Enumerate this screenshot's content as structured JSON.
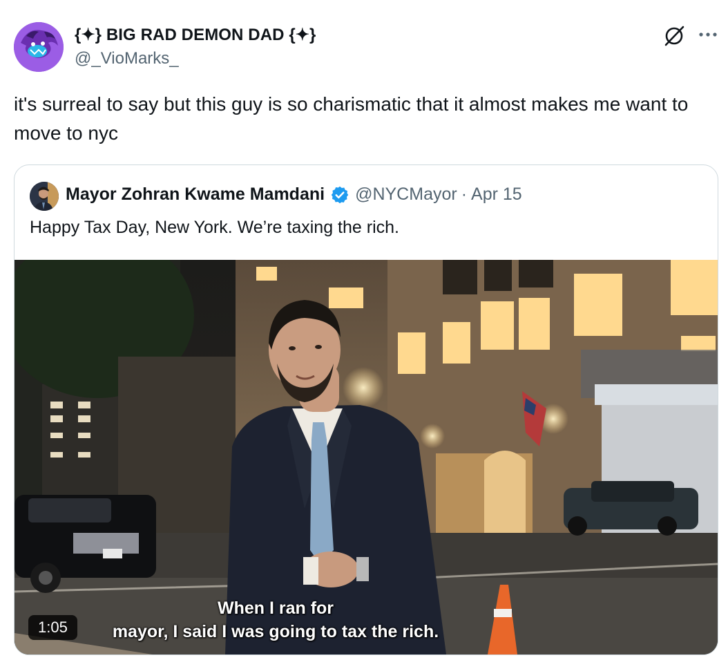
{
  "author": {
    "display_name": "{✦} BIG RAD DEMON DAD {✦}",
    "handle": "@_VioMarks_",
    "avatar_icon": "purple-demon-avatar"
  },
  "header_actions": {
    "grok_icon": "grok-icon",
    "more_icon": "more-dots-icon"
  },
  "tweet": {
    "text": "it's surreal to say but this guy is so charismatic that it almost makes me want to move to nyc"
  },
  "quoted_tweet": {
    "display_name": "Mayor Zohran Kwame Mamdani",
    "verified": true,
    "handle": "@NYCMayor",
    "separator": "·",
    "date": "Apr 15",
    "text": "Happy Tax Day, New York. We’re taxing the rich.",
    "video": {
      "duration": "1:05",
      "caption_line1": "When I ran for",
      "caption_line2": "mayor, I said I was going to tax the rich."
    }
  },
  "colors": {
    "text": "#0f1419",
    "secondary": "#536471",
    "border": "#cfd9de",
    "verified": "#1d9bf0"
  }
}
